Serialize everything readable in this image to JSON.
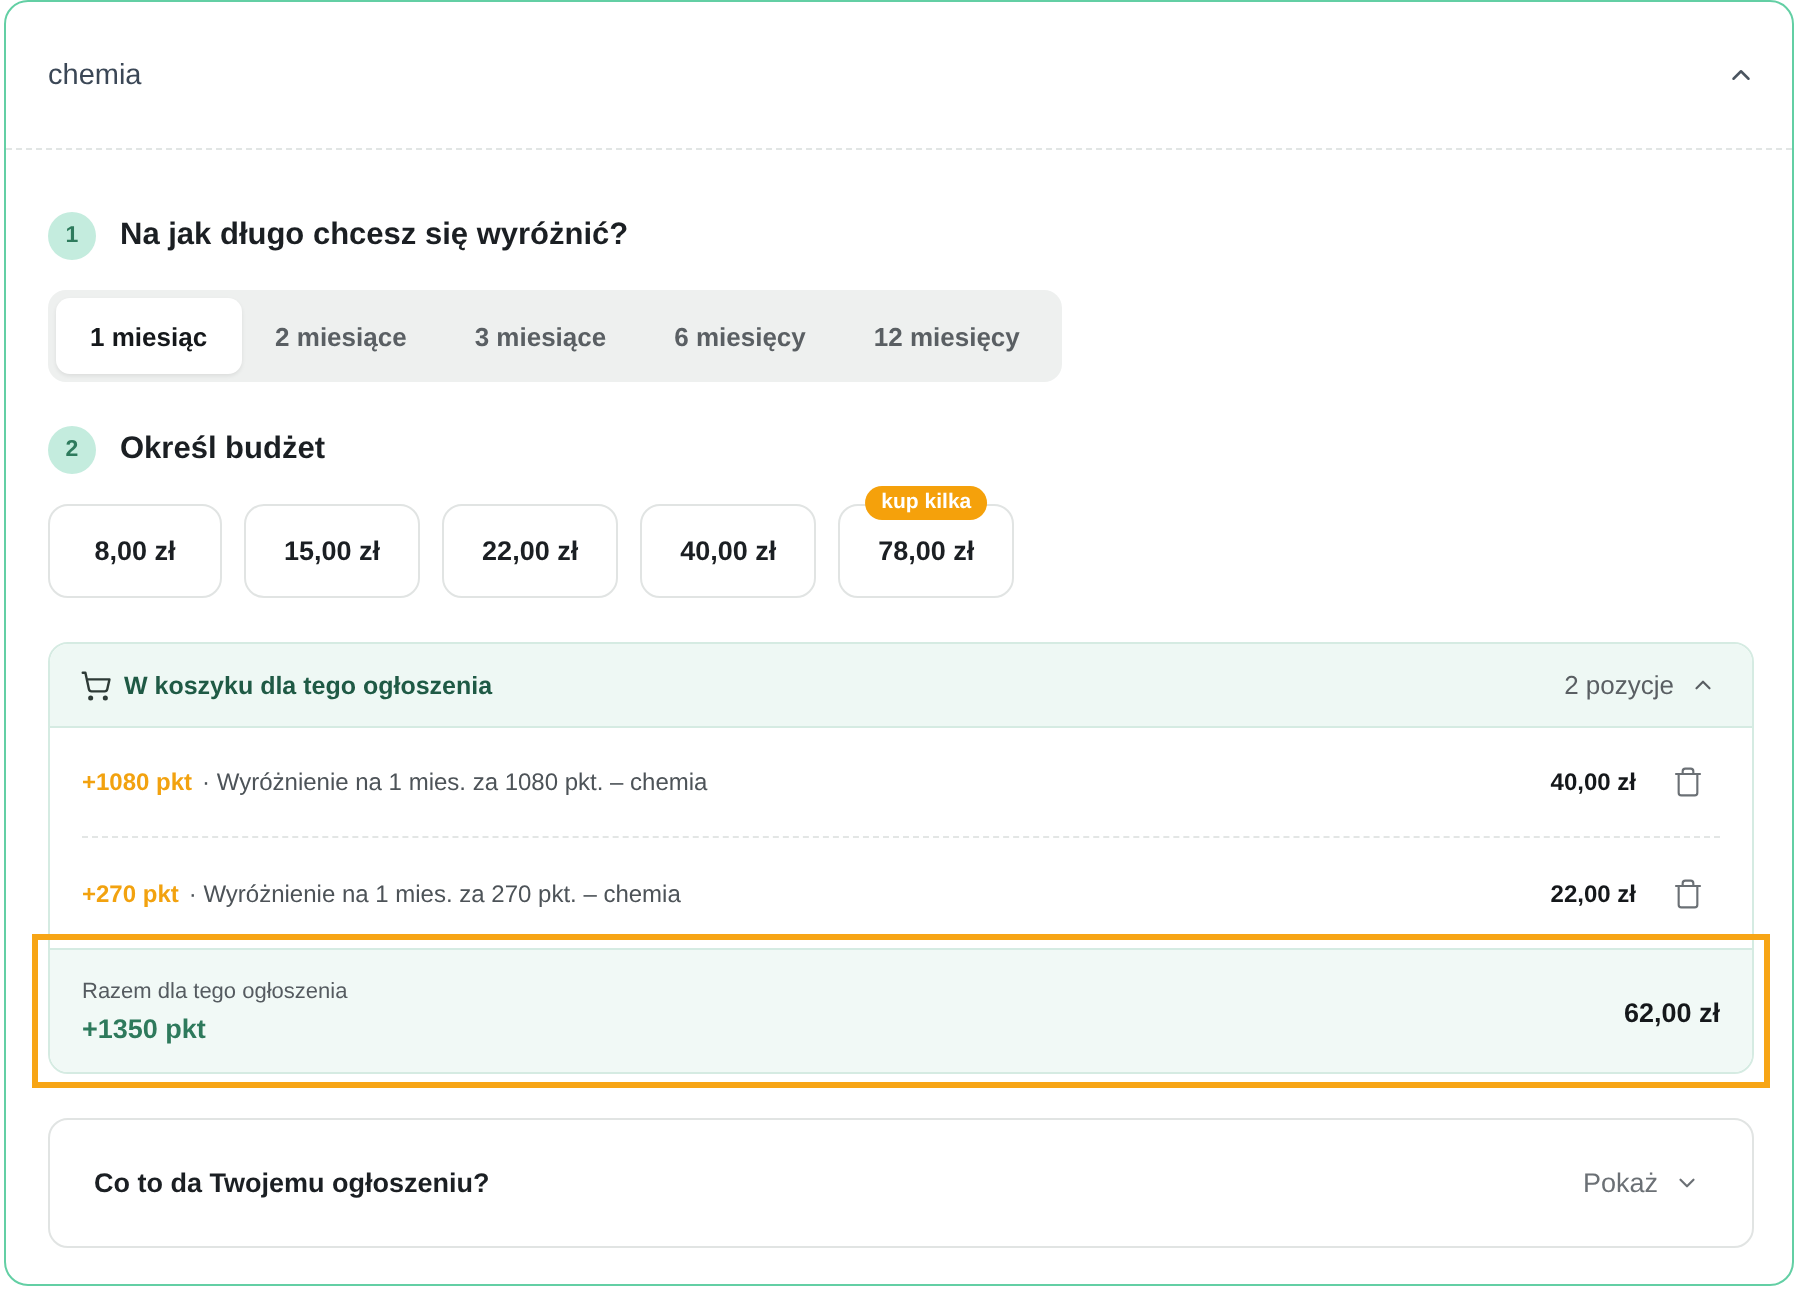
{
  "section": {
    "title": "chemia",
    "expanded": true
  },
  "steps": [
    {
      "kind": "duration",
      "number": "1",
      "title": "Na jak długo chcesz się wyróżnić?",
      "options": [
        {
          "label": "1 miesiąc",
          "selected": true
        },
        {
          "label": "2 miesiące",
          "selected": false
        },
        {
          "label": "3 miesiące",
          "selected": false
        },
        {
          "label": "6 miesięcy",
          "selected": false
        },
        {
          "label": "12 miesięcy",
          "selected": false
        }
      ]
    },
    {
      "kind": "budget",
      "number": "2",
      "title": "Określ budżet",
      "options": [
        {
          "label": "8,00 zł",
          "selected": false
        },
        {
          "label": "15,00 zł",
          "selected": false
        },
        {
          "label": "22,00 zł",
          "selected": false
        },
        {
          "label": "40,00 zł",
          "selected": false
        },
        {
          "label": "78,00 zł",
          "selected": false,
          "badge": "kup kilka"
        }
      ]
    }
  ],
  "cart": {
    "title": "W koszyku dla tego ogłoszenia",
    "count": "2 pozycje",
    "expanded": true,
    "items": [
      {
        "points": "+1080 pkt",
        "description": "· Wyróżnienie na 1 mies. za 1080 pkt. – chemia",
        "price": "40,00 zł"
      },
      {
        "points": "+270 pkt",
        "description": "· Wyróżnienie na 1 mies. za 270 pkt. – chemia",
        "price": "22,00 zł"
      }
    ],
    "total": {
      "label": "Razem dla tego ogłoszenia",
      "points": "+1350 pkt",
      "price": "62,00 zł"
    }
  },
  "info": {
    "title": "Co to da Twojemu ogłoszeniu?",
    "action": "Pokaż",
    "expanded": false
  }
}
